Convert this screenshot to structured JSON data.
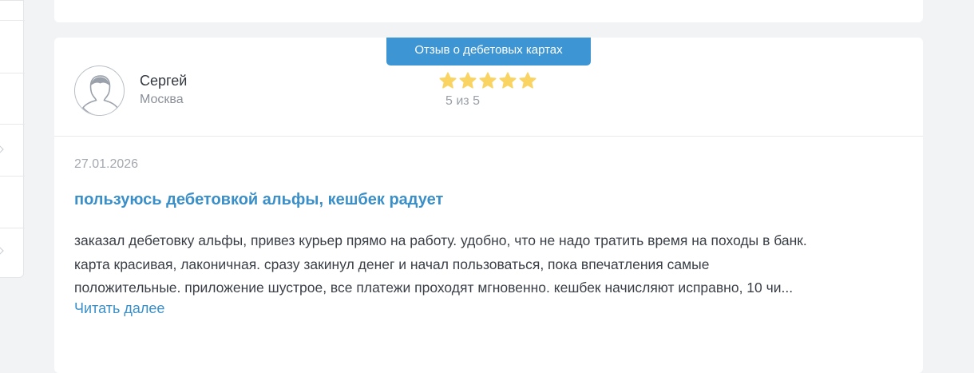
{
  "review": {
    "category_badge": "Отзыв о дебетовых картах",
    "author": {
      "name": "Сергей",
      "city": "Москва"
    },
    "rating": {
      "stars": 5,
      "max": 5,
      "text": "5 из 5"
    },
    "date": "27.01.2026",
    "title": "пользуюсь дебетовкой альфы, кешбек радует",
    "text_lines": [
      "заказал дебетовку альфы, привез курьер прямо на работу. удобно, что не надо тратить время на походы в банк.",
      "карта красивая, лаконичная. сразу закинул денег и начал пользоваться, пока впечатления самые",
      "положительные. приложение шустрое, все платежи проходят мгновенно. кешбек начисляют исправно, 10 чи..."
    ],
    "read_more": "Читать далее"
  },
  "colors": {
    "accent": "#3d96d3",
    "link": "#3a8fc9",
    "star": "#f9d463",
    "page_bg": "#f2f3f5"
  },
  "icons": {
    "avatar": "user-silhouette-icon",
    "star": "star-icon"
  }
}
